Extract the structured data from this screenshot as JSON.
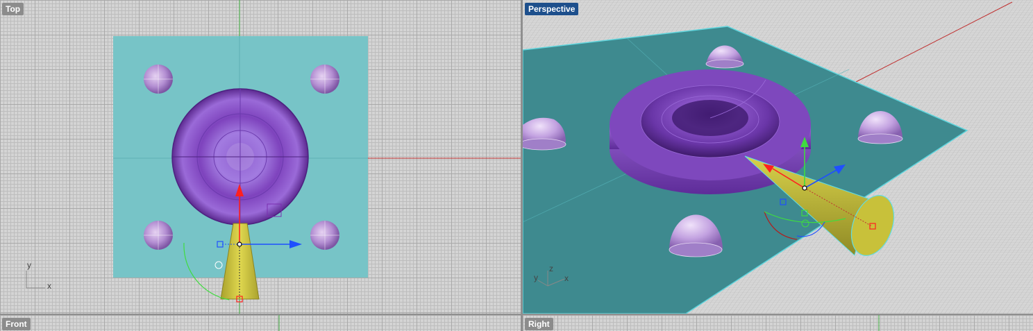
{
  "viewports": {
    "top": {
      "label": "Top",
      "active": false,
      "axis_x": "x",
      "axis_y": "y"
    },
    "perspective": {
      "label": "Perspective",
      "active": true,
      "axis_x": "x",
      "axis_y": "y",
      "axis_z": "z"
    },
    "front": {
      "label": "Front",
      "active": false
    },
    "right": {
      "label": "Right",
      "active": false
    }
  },
  "colors": {
    "viewport_bg": "#d4d4d4",
    "active_label": "#1d4f8c",
    "inactive_label": "#8c8c8c",
    "plane_top": "#77c4c7",
    "plane_perspective": "#3e8a8f",
    "torus": "#8a4fc2",
    "dome": "#b48ad6",
    "cone": "#c9c23a",
    "gizmo_x": "#ff2020",
    "gizmo_y": "#1f4fff",
    "gizmo_z": "#3fdc3f"
  },
  "scene_objects": [
    "plane",
    "torus",
    "dome",
    "dome",
    "dome",
    "dome",
    "cone",
    "gumball"
  ]
}
